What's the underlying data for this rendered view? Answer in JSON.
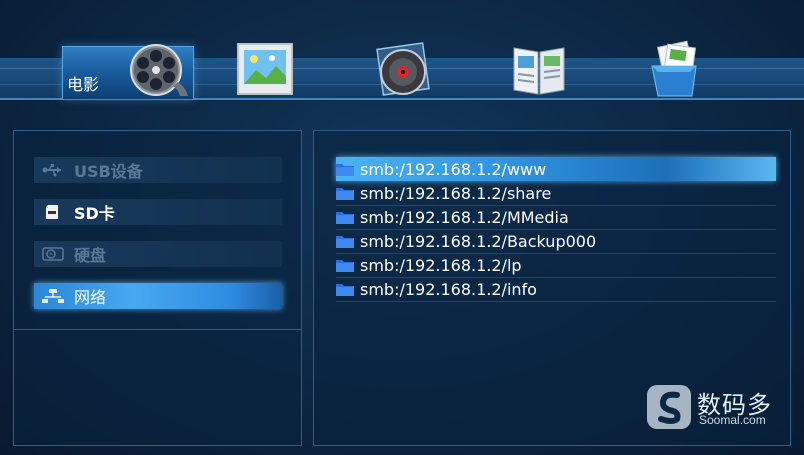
{
  "header": {
    "tabs": [
      {
        "label": "电影",
        "icon": "film-reel-icon",
        "active": true
      },
      {
        "label": "",
        "icon": "photo-frame-icon",
        "active": false
      },
      {
        "label": "",
        "icon": "music-disc-icon",
        "active": false
      },
      {
        "label": "",
        "icon": "ebook-icon",
        "active": false
      },
      {
        "label": "",
        "icon": "all-files-box-icon",
        "active": false
      }
    ]
  },
  "sources": [
    {
      "label": "USB设备",
      "icon": "usb-icon",
      "state": "disabled"
    },
    {
      "label": "SD卡",
      "icon": "sd-card-icon",
      "state": "normal"
    },
    {
      "label": "硬盘",
      "icon": "hard-disk-icon",
      "state": "disabled"
    },
    {
      "label": "网络",
      "icon": "network-icon",
      "state": "selected"
    }
  ],
  "files": [
    {
      "label": "smb:/192.168.1.2/www",
      "selected": true
    },
    {
      "label": "smb:/192.168.1.2/share",
      "selected": false
    },
    {
      "label": "smb:/192.168.1.2/MMedia",
      "selected": false
    },
    {
      "label": "smb:/192.168.1.2/Backup000",
      "selected": false
    },
    {
      "label": "smb:/192.168.1.2/lp",
      "selected": false
    },
    {
      "label": "smb:/192.168.1.2/info",
      "selected": false
    }
  ],
  "watermark": {
    "title": "数码多",
    "sub": "Soomal.com"
  },
  "colors": {
    "accent": "#3f9ce8",
    "background": "#0c2744",
    "disabled_text": "#5b7896"
  }
}
